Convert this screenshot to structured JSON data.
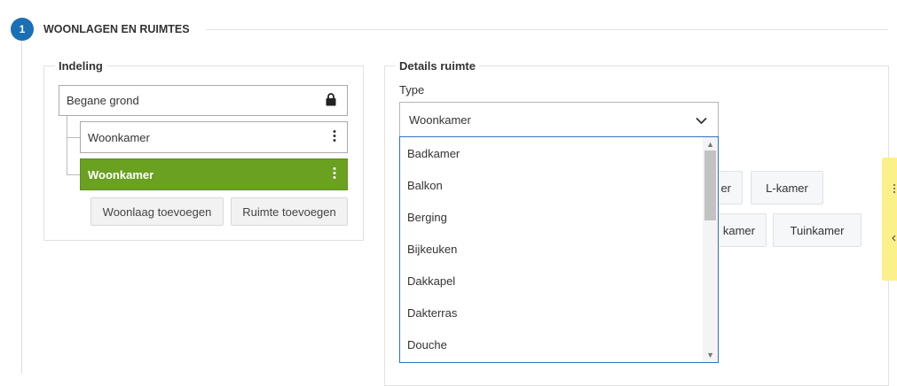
{
  "section": {
    "number": "1",
    "title": "WOONLAGEN EN RUIMTES"
  },
  "indeling": {
    "legend": "Indeling",
    "floor": {
      "label": "Begane grond",
      "icon": "lock-icon"
    },
    "rooms": [
      {
        "label": "Woonkamer",
        "active": false,
        "icon": "more-vertical-icon"
      },
      {
        "label": "Woonkamer",
        "active": true,
        "icon": "more-vertical-icon"
      }
    ],
    "buttons": {
      "add_floor": "Woonlaag toevoegen",
      "add_room": "Ruimte toevoegen"
    }
  },
  "details": {
    "legend": "Details ruimte",
    "type_label": "Type",
    "type_value": "Woonkamer",
    "options": [
      "Badkamer",
      "Balkon",
      "Berging",
      "Bijkeuken",
      "Dakkapel",
      "Dakterras",
      "Douche"
    ],
    "chips": [
      "er",
      "L-kamer",
      "kamer",
      "Tuinkamer"
    ]
  },
  "colors": {
    "accent": "#1a6fb5",
    "active_room": "#6aa121",
    "dropdown_border": "#2a74c5",
    "side_tab": "#fbf08a"
  }
}
